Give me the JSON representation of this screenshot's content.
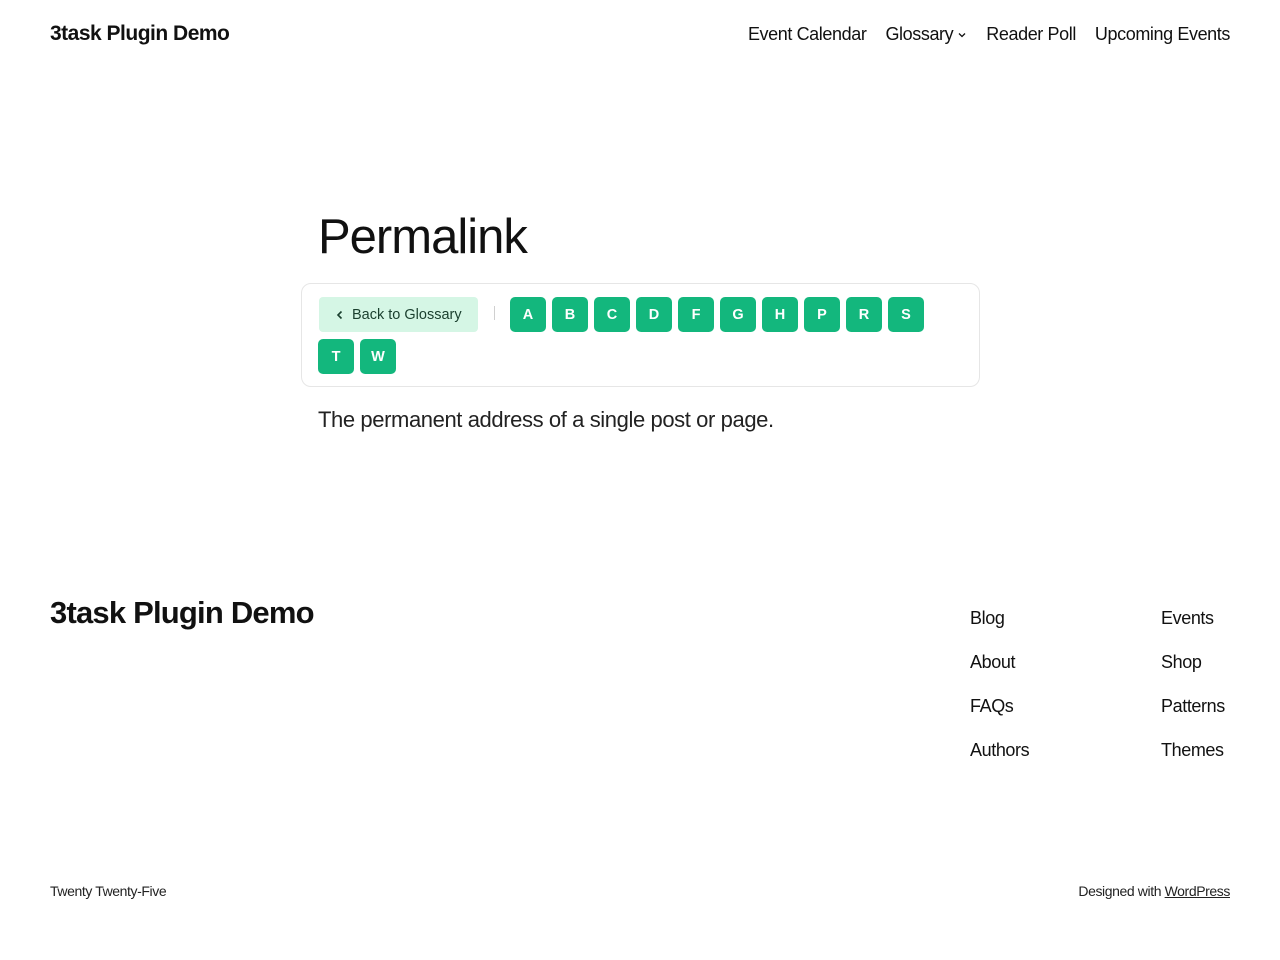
{
  "header": {
    "site_title": "3task Plugin Demo",
    "nav": [
      {
        "label": "Event Calendar"
      },
      {
        "label": "Glossary"
      },
      {
        "label": "Reader Poll"
      },
      {
        "label": "Upcoming Events"
      }
    ]
  },
  "main": {
    "title": "Permalink",
    "back_label": "Back to Glossary",
    "letters": [
      "A",
      "B",
      "C",
      "D",
      "F",
      "G",
      "H",
      "P",
      "R",
      "S",
      "T",
      "W"
    ],
    "description": "The permanent address of a single post or page."
  },
  "footer": {
    "site_title": "3task Plugin Demo",
    "col1": [
      "Blog",
      "About",
      "FAQs",
      "Authors"
    ],
    "col2": [
      "Events",
      "Shop",
      "Patterns",
      "Themes"
    ],
    "theme_credit": "Twenty Twenty-Five",
    "designed_with": "Designed with",
    "wordpress": "WordPress"
  },
  "colors": {
    "accent": "#13b77d",
    "back_button_bg": "#d5f6e5"
  }
}
